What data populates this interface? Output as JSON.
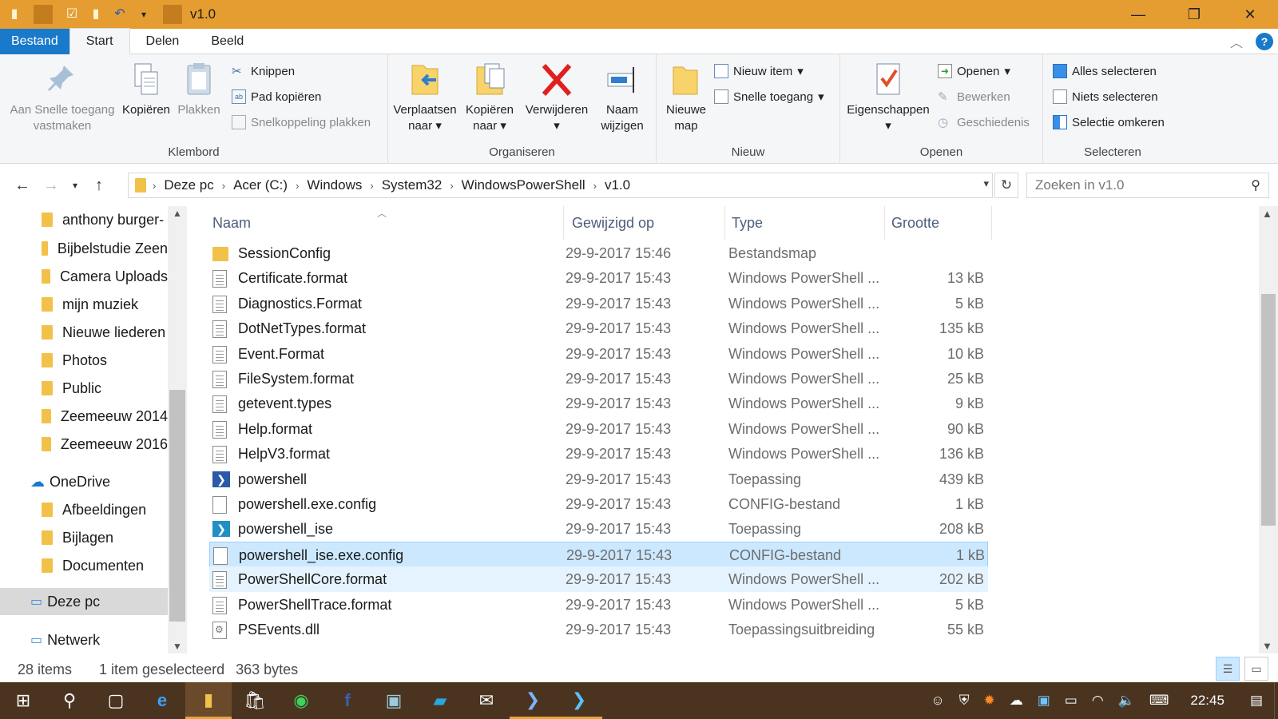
{
  "window": {
    "title": "v1.0",
    "controls": {
      "minimize": "—",
      "restore": "❐",
      "close": "✕"
    }
  },
  "tabs": {
    "file": "Bestand",
    "items": [
      "Start",
      "Delen",
      "Beeld"
    ]
  },
  "ribbon": {
    "klembord": {
      "label": "Klembord",
      "pin": "Aan Snelle toegang vastmaken",
      "copy": "Kopiëren",
      "paste": "Plakken",
      "cut": "Knippen",
      "copy_path": "Pad kopiëren",
      "paste_shortcut": "Snelkoppeling plakken"
    },
    "organiseren": {
      "label": "Organiseren",
      "move_to": "Verplaatsen naar",
      "copy_to": "Kopiëren naar",
      "delete": "Verwijderen",
      "rename": "Naam wijzigen"
    },
    "nieuw": {
      "label": "Nieuw",
      "new_folder": "Nieuwe map",
      "new_item": "Nieuw item",
      "easy_access": "Snelle toegang"
    },
    "openen": {
      "label": "Openen",
      "properties": "Eigenschappen",
      "open": "Openen",
      "edit": "Bewerken",
      "history": "Geschiedenis"
    },
    "selecteren": {
      "label": "Selecteren",
      "select_all": "Alles selecteren",
      "select_none": "Niets selecteren",
      "invert": "Selectie omkeren"
    }
  },
  "address": {
    "crumbs": [
      "Deze pc",
      "Acer (C:)",
      "Windows",
      "System32",
      "WindowsPowerShell",
      "v1.0"
    ],
    "search_placeholder": "Zoeken in v1.0"
  },
  "navpane": {
    "items": [
      {
        "label": "anthony burger-"
      },
      {
        "label": "Bijbelstudie Zeen"
      },
      {
        "label": "Camera Uploads"
      },
      {
        "label": "mijn muziek"
      },
      {
        "label": "Nieuwe liederen"
      },
      {
        "label": "Photos"
      },
      {
        "label": "Public"
      },
      {
        "label": "Zeemeeuw 2014"
      },
      {
        "label": "Zeemeeuw 2016"
      },
      {
        "label": "OneDrive"
      },
      {
        "label": "Afbeeldingen"
      },
      {
        "label": "Bijlagen"
      },
      {
        "label": "Documenten"
      },
      {
        "label": "Deze pc"
      },
      {
        "label": "Netwerk"
      }
    ]
  },
  "filelist": {
    "columns": {
      "name": "Naam",
      "date": "Gewijzigd op",
      "type": "Type",
      "size": "Grootte"
    },
    "rows": [
      {
        "name": "SessionConfig",
        "date": "29-9-2017 15:46",
        "type": "Bestandsmap",
        "size": "",
        "icon": "folder-icon"
      },
      {
        "name": "Certificate.format",
        "date": "29-9-2017 15:43",
        "type": "Windows PowerShell ...",
        "size": "13 kB",
        "icon": "document-icon"
      },
      {
        "name": "Diagnostics.Format",
        "date": "29-9-2017 15:43",
        "type": "Windows PowerShell ...",
        "size": "5 kB",
        "icon": "document-icon"
      },
      {
        "name": "DotNetTypes.format",
        "date": "29-9-2017 15:43",
        "type": "Windows PowerShell ...",
        "size": "135 kB",
        "icon": "document-icon"
      },
      {
        "name": "Event.Format",
        "date": "29-9-2017 15:43",
        "type": "Windows PowerShell ...",
        "size": "10 kB",
        "icon": "document-icon"
      },
      {
        "name": "FileSystem.format",
        "date": "29-9-2017 15:43",
        "type": "Windows PowerShell ...",
        "size": "25 kB",
        "icon": "document-icon"
      },
      {
        "name": "getevent.types",
        "date": "29-9-2017 15:43",
        "type": "Windows PowerShell ...",
        "size": "9 kB",
        "icon": "document-icon"
      },
      {
        "name": "Help.format",
        "date": "29-9-2017 15:43",
        "type": "Windows PowerShell ...",
        "size": "90 kB",
        "icon": "document-icon"
      },
      {
        "name": "HelpV3.format",
        "date": "29-9-2017 15:43",
        "type": "Windows PowerShell ...",
        "size": "136 kB",
        "icon": "document-icon"
      },
      {
        "name": "powershell",
        "date": "29-9-2017 15:43",
        "type": "Toepassing",
        "size": "439 kB",
        "icon": "powershell-icon"
      },
      {
        "name": "powershell.exe.config",
        "date": "29-9-2017 15:43",
        "type": "CONFIG-bestand",
        "size": "1 kB",
        "icon": "blank-file-icon"
      },
      {
        "name": "powershell_ise",
        "date": "29-9-2017 15:43",
        "type": "Toepassing",
        "size": "208 kB",
        "icon": "powershell-ise-icon"
      },
      {
        "name": "powershell_ise.exe.config",
        "date": "29-9-2017 15:43",
        "type": "CONFIG-bestand",
        "size": "1 kB",
        "icon": "blank-file-icon"
      },
      {
        "name": "PowerShellCore.format",
        "date": "29-9-2017 15:43",
        "type": "Windows PowerShell ...",
        "size": "202 kB",
        "icon": "document-icon"
      },
      {
        "name": "PowerShellTrace.format",
        "date": "29-9-2017 15:43",
        "type": "Windows PowerShell ...",
        "size": "5 kB",
        "icon": "document-icon"
      },
      {
        "name": "PSEvents.dll",
        "date": "29-9-2017 15:43",
        "type": "Toepassingsuitbreiding",
        "size": "55 kB",
        "icon": "dll-icon"
      }
    ]
  },
  "status": {
    "count": "28 items",
    "selected": "1 item geselecteerd",
    "bytes": "363 bytes"
  },
  "taskbar": {
    "clock": "22:45"
  },
  "colors": {
    "titlebar": "#e59d32",
    "file_tab": "#1979ca",
    "selection": "#cce8ff",
    "taskbar": "#4a3420"
  }
}
